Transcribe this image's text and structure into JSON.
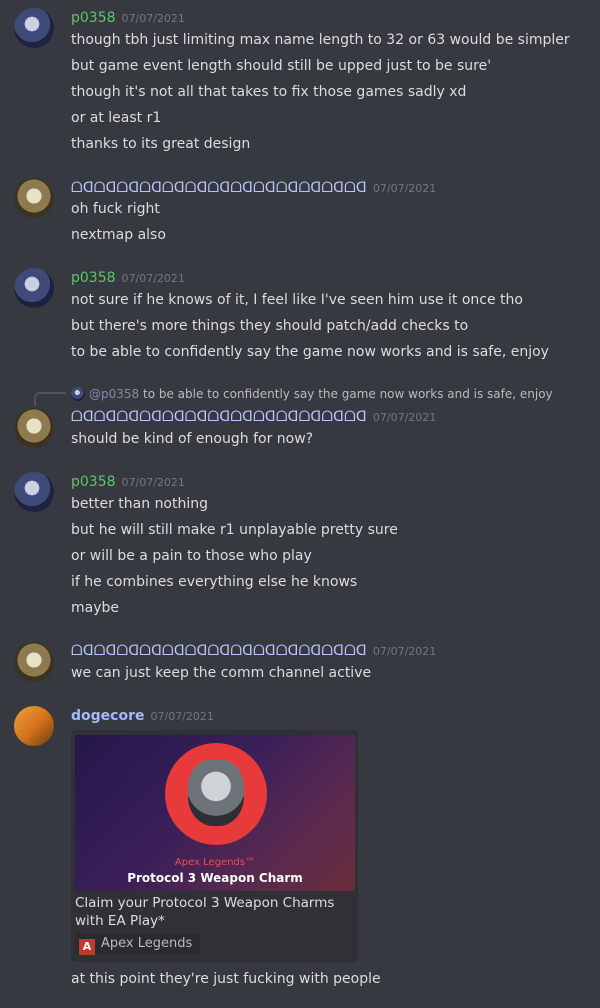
{
  "messages": [
    {
      "author": "p0358",
      "timestamp": "07/07/2021",
      "lines": [
        "though tbh just limiting max name length to 32 or 63 would be simpler",
        "but game event length should still be upped just to be sure'",
        "though it's not all that takes to fix those games sadly xd",
        "or at least r1",
        "thanks to its great design"
      ]
    },
    {
      "author": "ᗝᗡᗝᗡᗝᗡᗝᗡᗝᗡᗝᗡᗝᗡᗝᗡᗝᗡᗝᗡᗝᗡᗝᗡᗝᗡ",
      "timestamp": "07/07/2021",
      "lines": [
        "oh fuck right",
        "nextmap also"
      ]
    },
    {
      "author": "p0358",
      "timestamp": "07/07/2021",
      "lines": [
        "not sure if he knows of it, I feel like I've seen him use it once tho",
        "but there's more things they should patch/add checks to",
        "to be able to confidently say the game now works and is safe, enjoy"
      ]
    },
    {
      "reply": {
        "mention": "@p0358",
        "text": "to be able to confidently say the game now works and is safe, enjoy"
      },
      "author": "ᗝᗡᗝᗡᗝᗡᗝᗡᗝᗡᗝᗡᗝᗡᗝᗡᗝᗡᗝᗡᗝᗡᗝᗡᗝᗡ",
      "timestamp": "07/07/2021",
      "lines": [
        "should be kind of enough for now?"
      ]
    },
    {
      "author": "p0358",
      "timestamp": "07/07/2021",
      "lines": [
        "better than nothing",
        "but he will still make r1 unplayable pretty sure",
        "or will be a pain to those who play",
        "if he combines everything else he knows",
        "maybe"
      ]
    },
    {
      "author": "ᗝᗡᗝᗡᗝᗡᗝᗡᗝᗡᗝᗡᗝᗡᗝᗡᗝᗡᗝᗡᗝᗡᗝᗡᗝᗡ",
      "timestamp": "07/07/2021",
      "lines": [
        "we can just keep the comm channel active"
      ]
    },
    {
      "author": "dogecore",
      "timestamp": "07/07/2021",
      "embed": {
        "image_subtitle": "Apex Legends™",
        "image_caption": "Protocol 3 Weapon Charm",
        "title": "Claim your Protocol 3 Weapon Charms with EA Play*",
        "source": "Apex Legends",
        "source_icon": "A"
      },
      "lines": [
        "at this point they're just fucking with people"
      ]
    }
  ]
}
